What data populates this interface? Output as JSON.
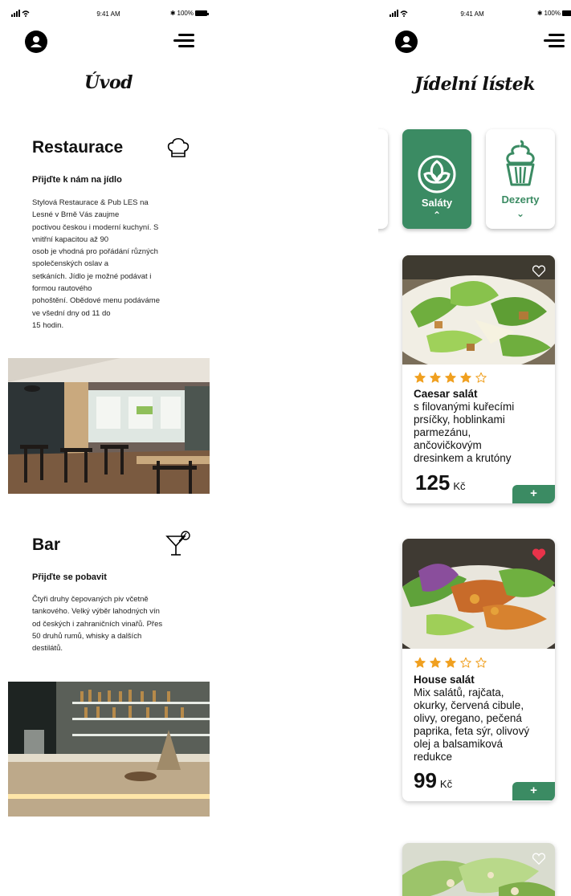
{
  "status_bar": {
    "time": "9:41 AM",
    "battery": "100%"
  },
  "intro_screen": {
    "title": "Úvod",
    "restaurant": {
      "heading": "Restaurace",
      "subheading": "Přijďte k nám na jídlo",
      "body_lines": [
        "Stylová Restaurace & Pub LES na",
        "Lesné v Brně Vás zaujme",
        "poctivou českou i moderní kuchyní. S",
        "vnitřní kapacitou až 90",
        "osob je vhodná pro pořádání různých",
        "společenských oslav a",
        "setkáních. Jídlo je možné podávat i",
        "formou rautového",
        "pohoštění. Obědové menu podáváme",
        "ve všední dny od 11 do",
        "15 hodin."
      ]
    },
    "bar": {
      "heading": "Bar",
      "subheading": "Přijďte se pobavit",
      "body_lines": [
        "Čtyři druhy čepovaných piv včetně",
        "tankového. Velký výběr lahodných vín",
        "od českých i zahraničních vinařů. Přes",
        "50 druhů rumů, whisky a dalších",
        "destilátů."
      ]
    }
  },
  "menu_screen": {
    "title": "Jídelní lístek",
    "categories": [
      {
        "label": "Saláty",
        "icon": "salad-icon",
        "active": true
      },
      {
        "label": "Dezerty",
        "icon": "cupcake-icon",
        "active": false
      }
    ],
    "items": [
      {
        "name": "Caesar salát",
        "desc_lines": [
          "s filovanými kuřecími",
          "prsíčky, hoblinkami",
          "parmezánu,",
          "ančovičkovým",
          "dresinkem a krutóny"
        ],
        "rating": 4,
        "price": "125",
        "currency": "Kč",
        "favorite": false,
        "add_label": "+"
      },
      {
        "name": "House salát",
        "desc_lines": [
          "Mix salátů, rajčata,",
          "okurky, červená cibule,",
          "olivy, oregano, pečená",
          "paprika, feta sýr, olivový",
          "olej a balsamiková",
          "redukce"
        ],
        "rating": 3,
        "price": "99",
        "currency": "Kč",
        "favorite": true,
        "add_label": "+"
      }
    ]
  },
  "colors": {
    "accent": "#3b8b63",
    "favorite": "#e8334a",
    "star": "#f0a020"
  }
}
